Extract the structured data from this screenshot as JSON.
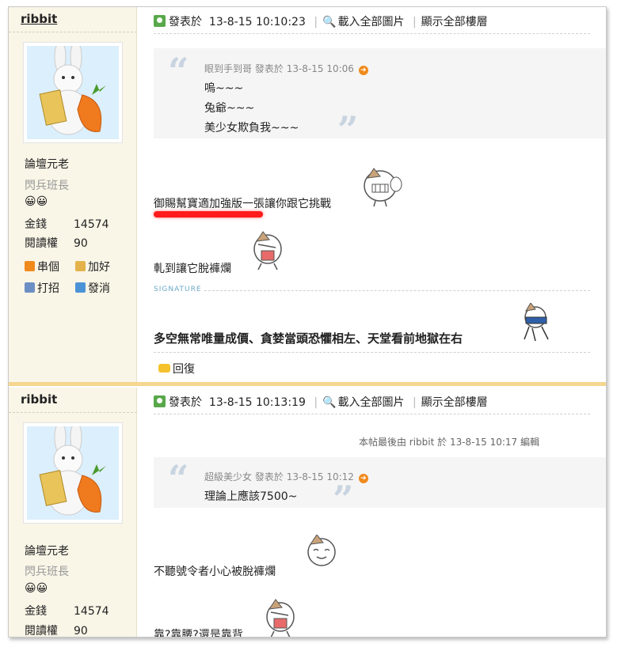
{
  "posts": [
    {
      "username": "ribbit",
      "rank_title": "論壇元老",
      "rank_sub": "閃兵班長",
      "stars": "😀😀",
      "stats": [
        {
          "label": "金錢",
          "value": "14574"
        },
        {
          "label": "閱讀權",
          "value": "90"
        }
      ],
      "actions": {
        "visit": "串個",
        "add_friend": "加好",
        "poke": "打招",
        "message": "發消"
      },
      "postinfo": {
        "posted_prefix": "發表於",
        "datetime": "13-8-15 10:10:23",
        "load_images": "載入全部圖片",
        "show_all_floors": "顯示全部樓層"
      },
      "quote": {
        "author": "眼到手到哥",
        "posted_prefix": "發表於",
        "datetime": "13-8-15 10:06",
        "lines": [
          "嗚~~~",
          "兔爺~~~",
          "美少女欺負我~~~"
        ]
      },
      "body": [
        "御賜幫寶適加強版一張讓你跟它挑戰",
        "軋到讓它脫褲爛"
      ],
      "signature_label": "SIGNATURE",
      "signature_text": "多空無常唯量成價、貪婪當頭恐懼相左、天堂看前地獄在右",
      "reply_label": "回復"
    },
    {
      "username": "ribbit",
      "rank_title": "論壇元老",
      "rank_sub": "閃兵班長",
      "stars": "😀😀",
      "stats": [
        {
          "label": "金錢",
          "value": "14574"
        },
        {
          "label": "閱讀權",
          "value": "90"
        }
      ],
      "postinfo": {
        "posted_prefix": "發表於",
        "datetime": "13-8-15 10:13:19",
        "load_images": "載入全部圖片",
        "show_all_floors": "顯示全部樓層"
      },
      "edited_note": "本帖最後由 ribbit 於 13-8-15 10:17 編輯",
      "quote": {
        "author": "超級美少女",
        "posted_prefix": "發表於",
        "datetime": "13-8-15 10:12",
        "lines": [
          "理論上應該7500~"
        ]
      },
      "body": [
        "不聽號令者小心被脫褲爛",
        "靠?靠腰?還是靠背"
      ]
    }
  ],
  "colors": {
    "sidebar_bg": "#f9f5e7",
    "divider": "#f6d58f",
    "quote_bg": "#f5f5f5",
    "signature_label": "#6aa9c8",
    "highlight": "#ff1b1b"
  }
}
